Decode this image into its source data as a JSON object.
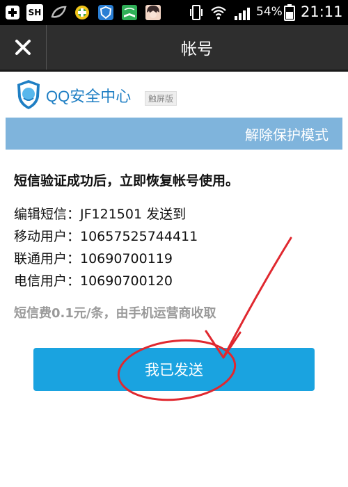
{
  "status_bar": {
    "battery_percent": "54%",
    "time": "21:11",
    "icons": [
      "add-icon",
      "sh-app-icon",
      "leaf-icon",
      "green-circle-app-icon",
      "shield-app-icon",
      "book-app-icon",
      "avatar-app-icon",
      "vibrate-icon",
      "wifi-icon",
      "signal-icon",
      "battery-icon"
    ],
    "sh_label": "SH"
  },
  "header": {
    "close_icon": "close-icon",
    "title": "帐号"
  },
  "brand": {
    "name": "QQ安全中心",
    "badge": "触屏版"
  },
  "section": {
    "title": "解除保护模式"
  },
  "content": {
    "headline": "短信验证成功后，立即恢复帐号使用。",
    "lines": [
      "编辑短信：JF121501 发送到",
      "移动用户：10657525744411",
      "联通用户：10690700119",
      "电信用户：10690700120"
    ],
    "fee_note": "短信费0.1元/条，由手机运营商收取"
  },
  "actions": {
    "send_label": "我已发送"
  },
  "colors": {
    "status_bar": "#000000",
    "title_bar": "#2e2e2e",
    "brand_blue": "#1f7fc4",
    "banner": "#7fb4dc",
    "button": "#1aa3e0",
    "annotation_red": "#e0282f"
  }
}
